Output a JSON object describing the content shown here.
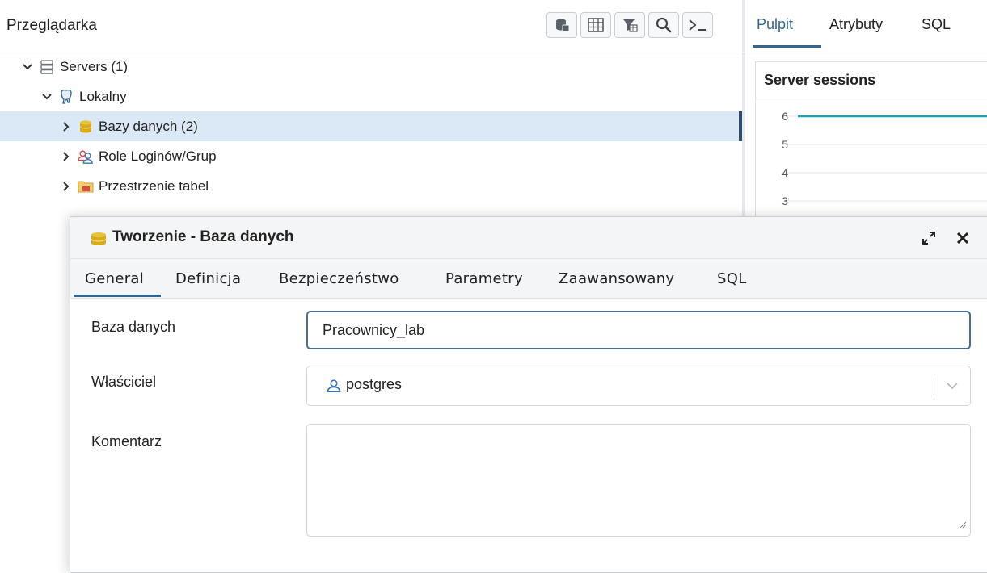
{
  "browser": {
    "title": "Przeglądarka",
    "toolbar": [
      {
        "icon": "database-icon"
      },
      {
        "icon": "table-icon"
      },
      {
        "icon": "filter-table-icon"
      },
      {
        "icon": "search-icon"
      },
      {
        "icon": "terminal-icon"
      }
    ],
    "tree": {
      "servers": "Servers (1)",
      "server": "Lokalny",
      "databases": "Bazy danych (2)",
      "roles": "Role Loginów/Grup",
      "tablespaces": "Przestrzenie tabel"
    }
  },
  "dashboard": {
    "tabs": [
      "Pulpit",
      "Atrybuty",
      "SQL"
    ],
    "active_tab": "Pulpit",
    "card_title": "Server sessions",
    "chart_data": {
      "type": "line",
      "title": "Server sessions",
      "yticks": [
        "6",
        "5",
        "4",
        "3"
      ],
      "series": [
        {
          "values": [
            6,
            6,
            6,
            6
          ]
        }
      ],
      "line_color": "#17a2b8"
    }
  },
  "dialog": {
    "title": "Tworzenie - Baza danych",
    "tabs": [
      "General",
      "Definicja",
      "Bezpieczeństwo",
      "Parametry",
      "Zaawansowany",
      "SQL"
    ],
    "active_tab": "General",
    "fields": {
      "database_label": "Baza danych",
      "database_value": "Pracownicy_lab",
      "owner_label": "Właściciel",
      "owner_value": "postgres",
      "comment_label": "Komentarz",
      "comment_value": ""
    }
  },
  "colors": {
    "accent": "#326690",
    "selected_row": "#dbe8f5",
    "chart_line": "#17a2b8"
  }
}
